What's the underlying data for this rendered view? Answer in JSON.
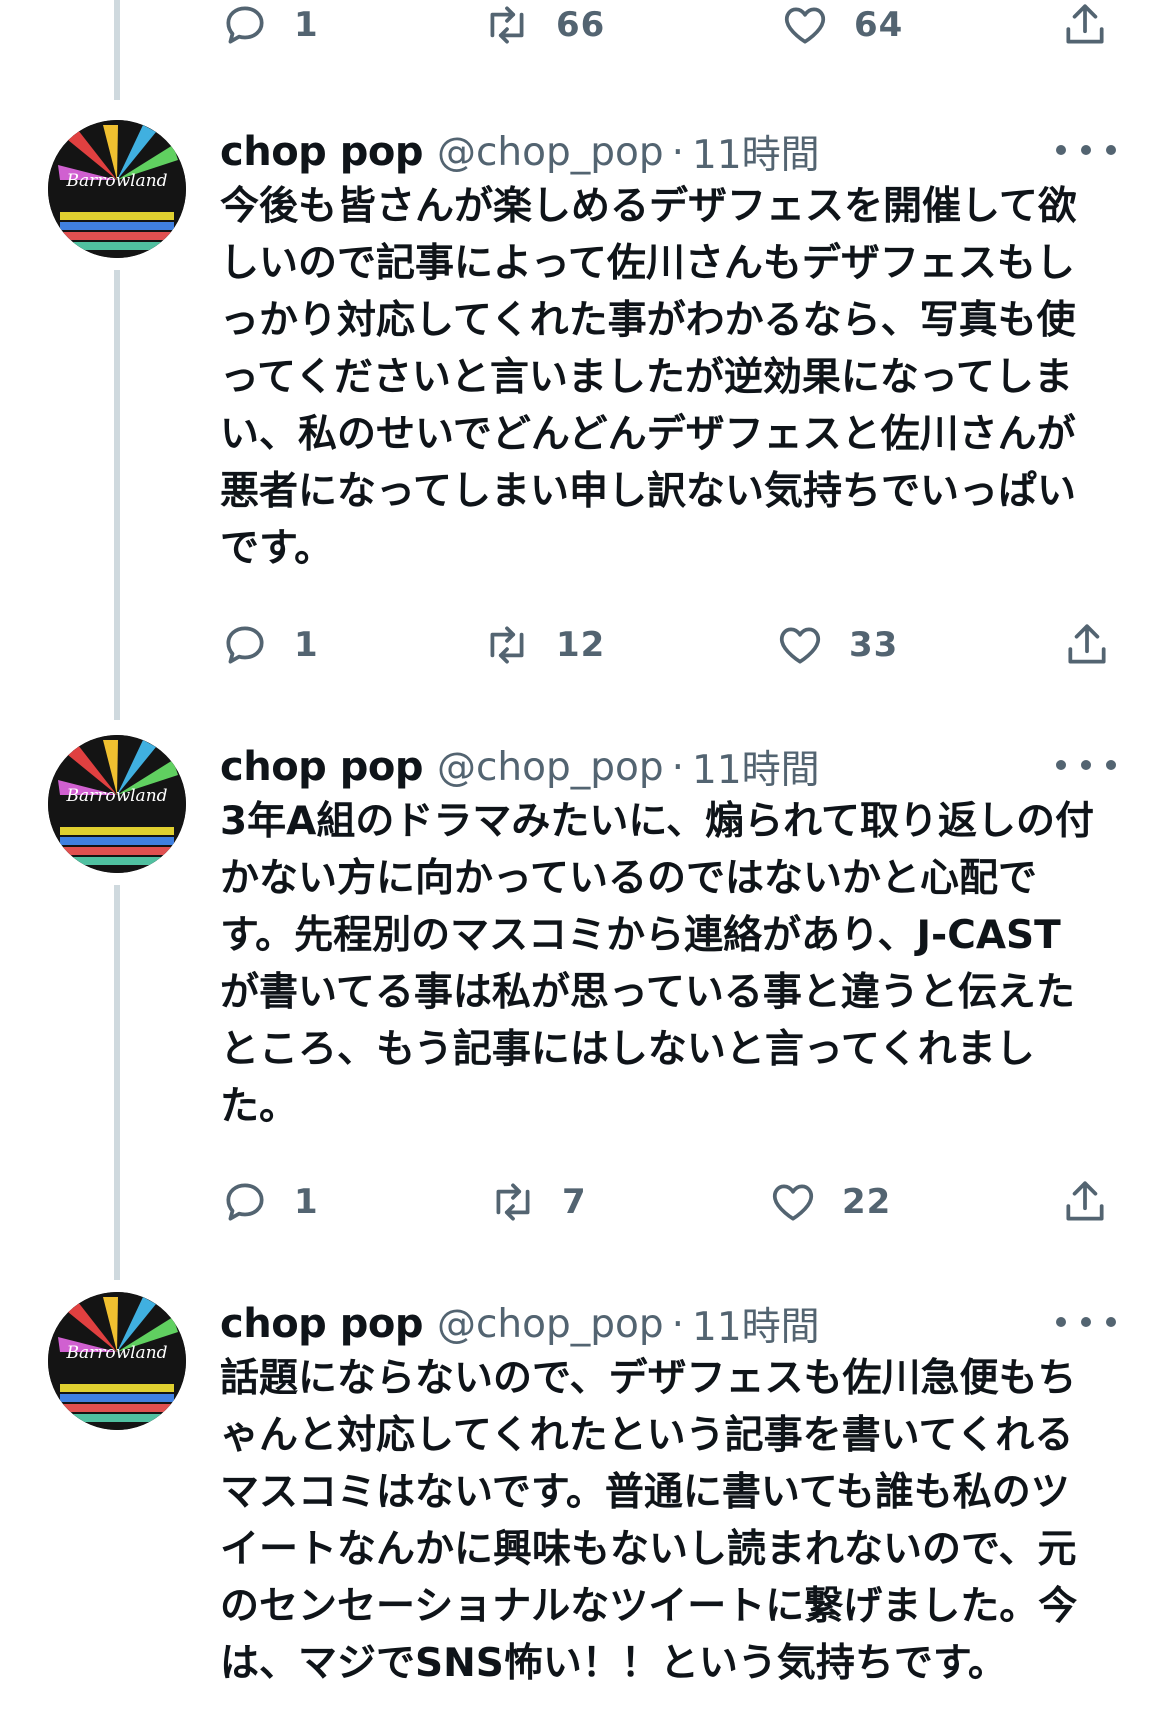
{
  "top_actions": {
    "reply": "1",
    "retweet": "66",
    "like": "64"
  },
  "tweets": [
    {
      "name": "chop pop",
      "handle": "@chop_pop",
      "separator": "·",
      "time": "11時間",
      "lines": [
        "今後も皆さんが楽しめるデザフェスを開催して欲",
        "しいので記事によって佐川さんもデザフェスもし",
        "っかり対応してくれた事がわかるなら、写真も使",
        "ってくださいと言いましたが逆効果になってしま",
        "い、私のせいでどんどんデザフェスと佐川さんが",
        "悪者になってしまい申し訳ない気持ちでいっぱい",
        "です。"
      ],
      "reply": "1",
      "retweet": "12",
      "like": "33"
    },
    {
      "name": "chop pop",
      "handle": "@chop_pop",
      "separator": "·",
      "time": "11時間",
      "lines": [
        "3年A組のドラマみたいに、煽られて取り返しの付",
        "かない方に向かっているのではないかと心配で",
        "す。先程別のマスコミから連絡があり、J-CAST",
        "が書いてる事は私が思っている事と違うと伝えた",
        "ところ、もう記事にはしないと言ってくれまし",
        "た。"
      ],
      "reply": "1",
      "retweet": "7",
      "like": "22"
    },
    {
      "name": "chop pop",
      "handle": "@chop_pop",
      "separator": "·",
      "time": "11時間",
      "lines": [
        "話題にならないので、デザフェスも佐川急便もち",
        "ゃんと対応してくれたという記事を書いてくれる",
        "マスコミはないです。普通に書いても誰も私のツ",
        "イートなんかに興味もないし読まれないので、元",
        "のセンセーショナルなツイートに繋げました。今",
        "は、マジでSNS怖い！！という気持ちです。"
      ]
    }
  ],
  "avatar_text": "Barrowland",
  "colors": {
    "text": "#0f1419",
    "secondary": "#536471",
    "thread_line": "#cfd9de",
    "background": "#ffffff"
  },
  "icons": {
    "reply": "reply-icon",
    "retweet": "retweet-icon",
    "like": "heart-icon",
    "share": "share-icon",
    "more": "more-icon"
  }
}
